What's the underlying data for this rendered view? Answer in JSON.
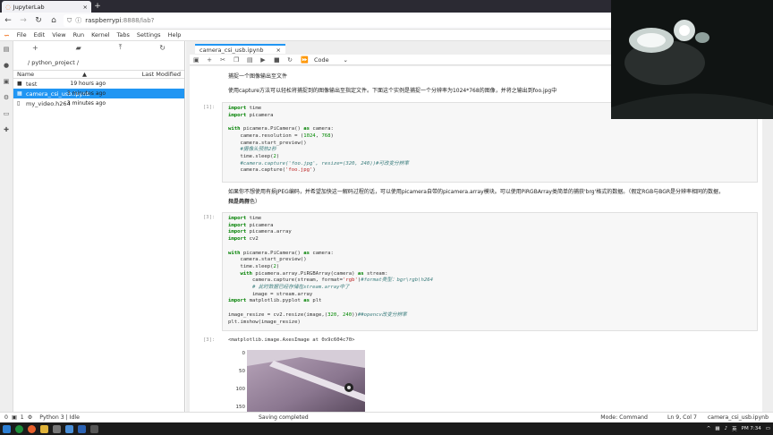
{
  "browser": {
    "tab_title": "JupyterLab",
    "url_host": "raspberrypi",
    "url_rest": ":8888/lab?"
  },
  "menu": [
    "File",
    "Edit",
    "View",
    "Run",
    "Kernel",
    "Tabs",
    "Settings",
    "Help"
  ],
  "filebrowser": {
    "path": "/ python_project /",
    "col_name": "Name",
    "col_modified": "Last Modified",
    "files": [
      {
        "name": "test",
        "modified": "19 hours ago",
        "type": "folder"
      },
      {
        "name": "camera_csi_usb.ipynb",
        "modified": "3 minutes ago",
        "type": "notebook"
      },
      {
        "name": "my_video.h264",
        "modified": "3 minutes ago",
        "type": "file"
      }
    ]
  },
  "notebook": {
    "tab_label": "camera_csi_usb.ipynb",
    "cell_type": "Code",
    "md1": "捕捉一个图像输出至文件",
    "md2": "使用capture方法可以轻松将捕捉到的图像输出至指定文件。下面这个实例是捕捉一个分辨率为1024*768的图像，并将之输出到foo.jpg中",
    "prompt1": "[1]:",
    "md3": "如果你不想使用有损JPEG编码，并希望加快这一解码过程的话，可以使用picamera自带的picamera.array模块。可以使用PiRGBArray类简单的捕获'brg'格式的数据。（假定RGB与BGR是分辨率相同的数据，只是具有",
    "md3b": "相反的颜色）",
    "prompt2": "[3]:",
    "prompt3": "[3]:",
    "output_text": "<matplotlib.image.AxesImage at 0x9c604c70>",
    "yticks": [
      "0",
      "50",
      "100",
      "150"
    ]
  },
  "status": {
    "left_a": "0",
    "left_b": "1",
    "kernel": "Python 3 | Idle",
    "center": "Saving completed",
    "mode": "Mode: Command",
    "pos": "Ln 9, Col 7",
    "file": "camera_csi_usb.ipynb"
  },
  "taskbar": {
    "ime": "英",
    "clock": "PM 7:34"
  }
}
